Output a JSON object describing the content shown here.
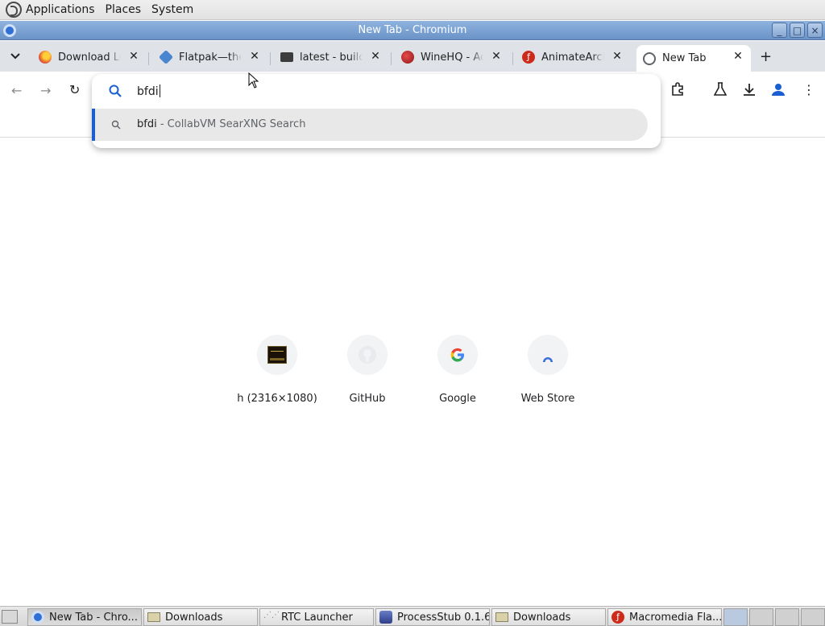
{
  "top_panel": {
    "menus": [
      "Applications",
      "Places",
      "System"
    ]
  },
  "window": {
    "title": "New Tab - Chromium",
    "buttons": [
      "_",
      "□",
      "×"
    ]
  },
  "tabs": [
    {
      "title": "Download Lu",
      "icon": "firefox-icon",
      "color": "#e8632a"
    },
    {
      "title": "Flatpak—the",
      "icon": "flatpak-icon",
      "color": "#4a86cf"
    },
    {
      "title": "latest - build",
      "icon": "folder-icon",
      "color": "#3c3c3c"
    },
    {
      "title": "WineHQ - Ad",
      "icon": "wine-icon",
      "color": "#8b1a1a"
    },
    {
      "title": "AnimateArch",
      "icon": "flash-icon",
      "color": "#cc2a1a"
    },
    {
      "title": "New Tab",
      "icon": "globe-icon",
      "color": "#5f6368",
      "active": true
    }
  ],
  "omnibox": {
    "query": "bfdi",
    "suggestion": {
      "query": "bfdi",
      "description": " - CollabVM SearXNG Search"
    }
  },
  "shortcuts": [
    {
      "label": "h (2316×1080)",
      "icon": "image-thumbnail-icon"
    },
    {
      "label": "GitHub",
      "icon": "github-icon"
    },
    {
      "label": "Google",
      "icon": "google-icon"
    },
    {
      "label": "Web Store",
      "icon": "web-store-icon"
    }
  ],
  "taskbar": [
    {
      "label": "New Tab - Chro...",
      "icon": "chromium-icon",
      "active": true
    },
    {
      "label": "Downloads",
      "icon": "folder-icon"
    },
    {
      "label": "RTC Launcher",
      "icon": "rtc-icon"
    },
    {
      "label": "ProcessStub 0.1.6",
      "icon": "app-icon"
    },
    {
      "label": "Downloads",
      "icon": "folder-icon"
    },
    {
      "label": "Macromedia Fla...",
      "icon": "flash-icon"
    }
  ],
  "colors": {
    "accent": "#1a5fd1",
    "titlebar": "#7aa0d3",
    "tabstrip": "#dfe3e8"
  }
}
